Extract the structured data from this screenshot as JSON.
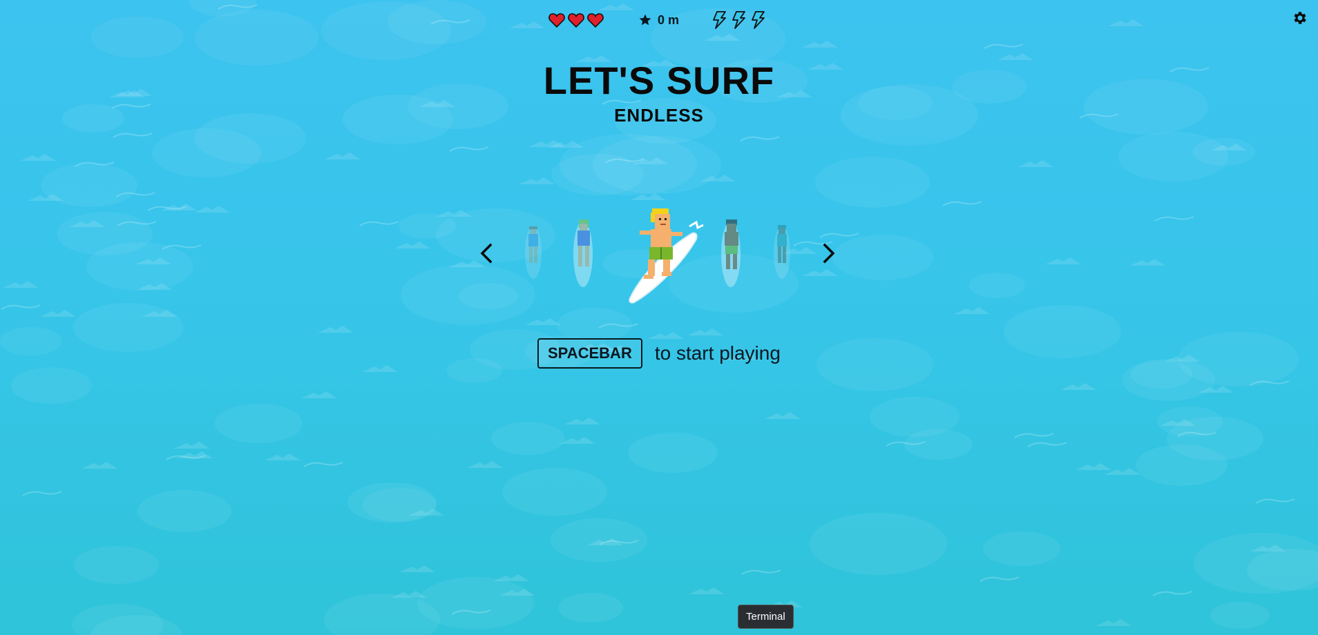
{
  "hud": {
    "lives": 3,
    "boosts": 3,
    "distance": "0 m"
  },
  "title": "LET'S SURF",
  "mode": "ENDLESS",
  "character_select": {
    "characters": [
      "surfer-1",
      "surfer-2",
      "surfer-3-selected",
      "surfer-4",
      "surfer-5"
    ],
    "selected_index": 2
  },
  "start_prompt": {
    "key": "SPACEBAR",
    "text": "to start playing"
  },
  "tooltip": "Terminal",
  "colors": {
    "ocean": "#3cc3ef",
    "heart": "#e0202a",
    "boost": "#37c5ea",
    "text": "#0a1720"
  },
  "icons": {
    "heart": "heart-icon",
    "star": "star-icon",
    "boost": "lightning-icon",
    "settings": "gear-icon",
    "prev": "chevron-left-icon",
    "next": "chevron-right-icon"
  }
}
